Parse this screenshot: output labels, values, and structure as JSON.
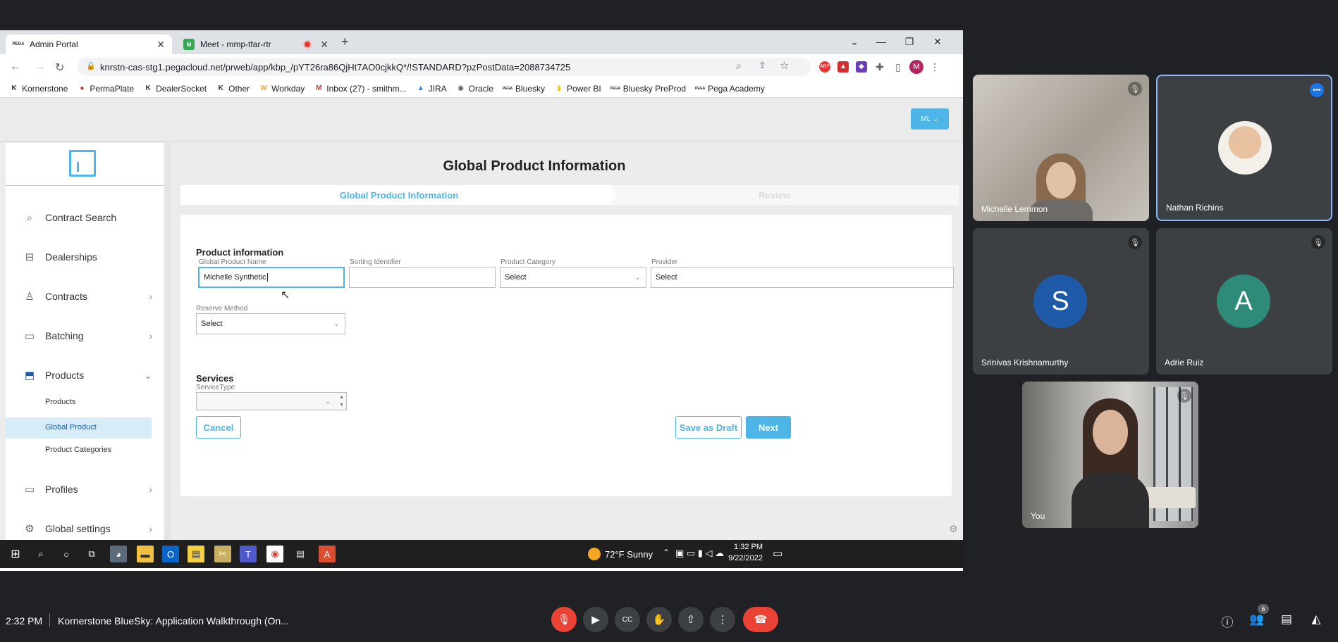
{
  "browser": {
    "tabs": [
      {
        "label": "Admin Portal",
        "favicon": "PEGA"
      },
      {
        "label": "Meet - mmp-tfar-rtr",
        "favicon": "M"
      }
    ],
    "url": "knrstn-cas-stg1.pegacloud.net/prweb/app/kbp_/pYT26ra86QjHt7AO0cjkkQ*/!STANDARD?pzPostData=2088734725",
    "profile_initial": "M",
    "bookmarks": [
      {
        "label": "Kornerstone",
        "icon": "K"
      },
      {
        "label": "PermaPlate",
        "icon": "●"
      },
      {
        "label": "DealerSocket",
        "icon": "K"
      },
      {
        "label": "Other",
        "icon": "K"
      },
      {
        "label": "Workday",
        "icon": "W"
      },
      {
        "label": "Inbox (27) - smithm...",
        "icon": "M"
      },
      {
        "label": "JIRA",
        "icon": "▲"
      },
      {
        "label": "Oracle",
        "icon": "◉"
      },
      {
        "label": "Bluesky",
        "icon": "PEGA"
      },
      {
        "label": "Power BI",
        "icon": "▮"
      },
      {
        "label": "Bluesky PreProd",
        "icon": "PEGA"
      },
      {
        "label": "Pega Academy",
        "icon": "PEGA"
      }
    ]
  },
  "app": {
    "user_button": "ML",
    "sidebar": {
      "items": [
        {
          "label": "Contract Search",
          "icon": "⌕"
        },
        {
          "label": "Dealerships",
          "icon": "⊟"
        },
        {
          "label": "Contracts",
          "icon": "♙"
        },
        {
          "label": "Batching",
          "icon": "▭"
        },
        {
          "label": "Products",
          "icon": "⬒"
        },
        {
          "label": "Profiles",
          "icon": "▭"
        },
        {
          "label": "Global settings",
          "icon": "⚙"
        }
      ],
      "products_sub": [
        "Products",
        "Global Product",
        "Product Categories"
      ]
    },
    "page_title": "Global Product Information",
    "steps": [
      "Global Product Information",
      "Review"
    ],
    "form": {
      "product_section": "Product information",
      "labels": {
        "name": "Global Product Name",
        "sorting": "Sorting Identifier",
        "category": "Product Category",
        "provider": "Provider",
        "reserve": "Reserve Method",
        "service_type": "ServiceType"
      },
      "values": {
        "name": "Michelle Synthetic",
        "sorting": "",
        "category": "Select",
        "provider": "Select",
        "reserve": "Select",
        "service_type": ""
      },
      "services_section": "Services",
      "buttons": {
        "cancel": "Cancel",
        "draft": "Save as Draft",
        "next": "Next"
      }
    }
  },
  "taskbar": {
    "weather": "72°F  Sunny",
    "time": "1:32 PM",
    "date": "9/22/2022"
  },
  "meet": {
    "participants": [
      {
        "name": "Michelle Lemmon"
      },
      {
        "name": "Nathan Richins"
      },
      {
        "name": "Srinivas Krishnamurthy",
        "initial": "S",
        "color": "#1e5aa8"
      },
      {
        "name": "Adrie Ruiz",
        "initial": "A",
        "color": "#2e8b7a"
      },
      {
        "name": "You"
      }
    ],
    "clock": "2:32 PM",
    "meeting_title": "Kornerstone BlueSky: Application Walkthrough (On...",
    "people_count": "6"
  }
}
